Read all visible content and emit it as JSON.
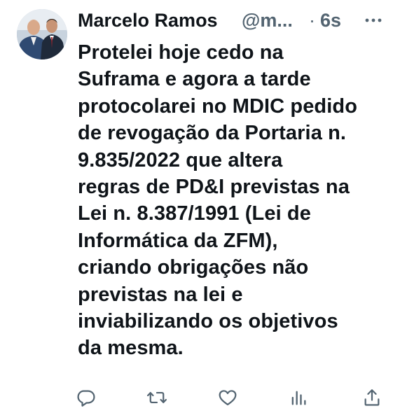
{
  "tweet": {
    "author_name": "Marcelo Ramos",
    "handle": "@m...",
    "separator": "·",
    "time": "6s",
    "text_lines": [
      "Protelei hoje cedo na",
      "Suframa e agora a tarde",
      "protocolarei no MDIC pedido",
      "de revogação da Portaria n.",
      "9.835/2022 que altera",
      "regras de PD&I previstas na",
      "Lei n. 8.387/1991 (Lei de",
      "Informática da ZFM),",
      "criando obrigações não",
      "previstas na lei e",
      "inviabilizando os objetivos",
      "da mesma."
    ]
  },
  "icons": {
    "more": "more-horizontal-icon",
    "reply": "reply-icon",
    "retweet": "retweet-icon",
    "like": "heart-icon",
    "views": "analytics-icon",
    "share": "share-icon"
  },
  "colors": {
    "text": "#0f1419",
    "secondary": "#536471",
    "background": "#ffffff"
  }
}
